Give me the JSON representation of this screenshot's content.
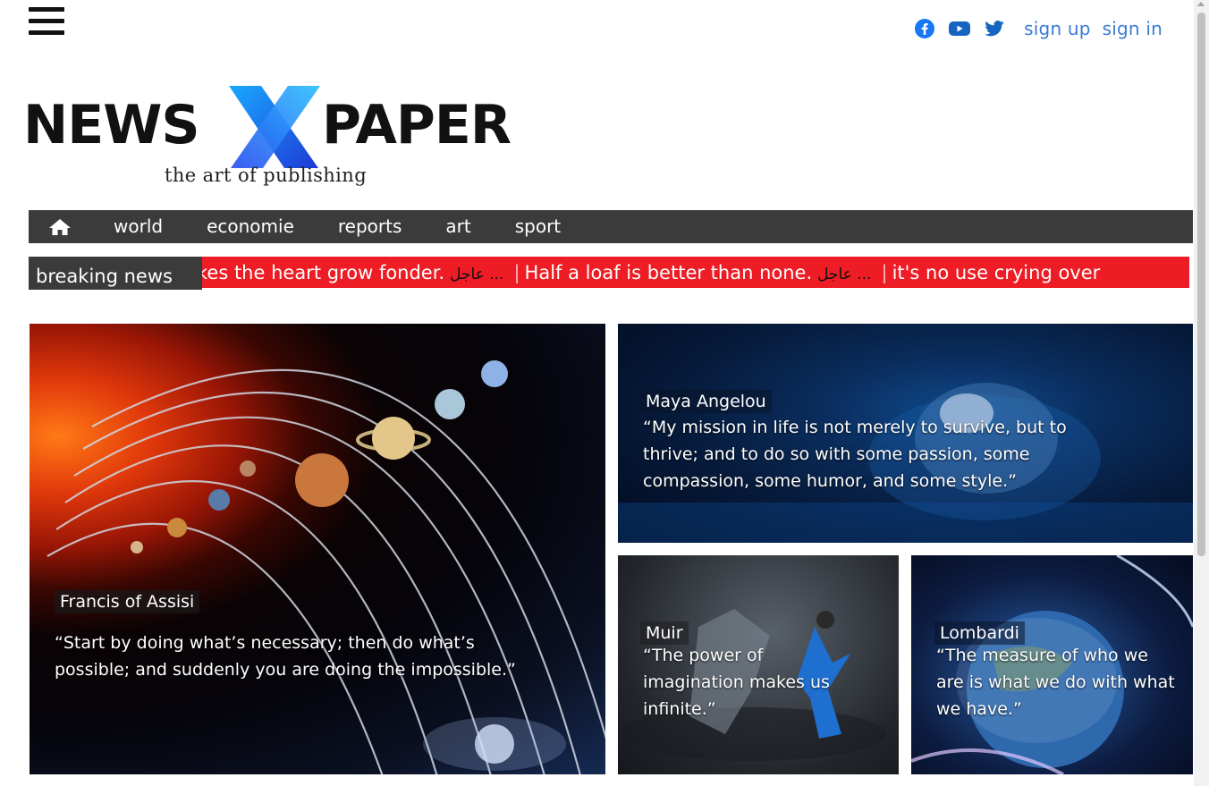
{
  "header": {
    "social": [
      {
        "icon": "facebook-icon",
        "color": "#1877f2"
      },
      {
        "icon": "youtube-icon",
        "color": "#1565c0"
      },
      {
        "icon": "twitter-icon",
        "color": "#1565c0"
      }
    ],
    "signup_label": "sign up",
    "signin_label": "sign in"
  },
  "logo": {
    "word_left": "NEWS",
    "word_right": "PAPER",
    "letter": "X",
    "tagline": "the art of publishing"
  },
  "nav": {
    "home_icon": "home-icon",
    "items": [
      "world",
      "economie",
      "reports",
      "art",
      "sport"
    ]
  },
  "breaking": {
    "label": "breaking news",
    "items": [
      {
        "text": "kes the heart grow fonder.",
        "tag": "عاجل ..."
      },
      {
        "text": "Half a loaf is better than none.",
        "tag": "عاجل ..."
      },
      {
        "text": "it's no use crying over",
        "tag": ""
      }
    ],
    "accent_color": "#ee1c24"
  },
  "cards": [
    {
      "author": "Francis of Assisi",
      "quote": "“Start by doing what’s necessary; then do what’s possible; and suddenly you are doing the impossible.”"
    },
    {
      "author": "Maya Angelou",
      "quote": "“My mission in life is not merely to survive, but to thrive; and to do so with some passion, some compassion, some humor, and some style.”"
    },
    {
      "author": "Muir",
      "quote": "“The power of imagination makes us infinite.”"
    },
    {
      "author": "Lombardi",
      "quote": "“The measure of who we are is what we do with what we have.”"
    }
  ]
}
